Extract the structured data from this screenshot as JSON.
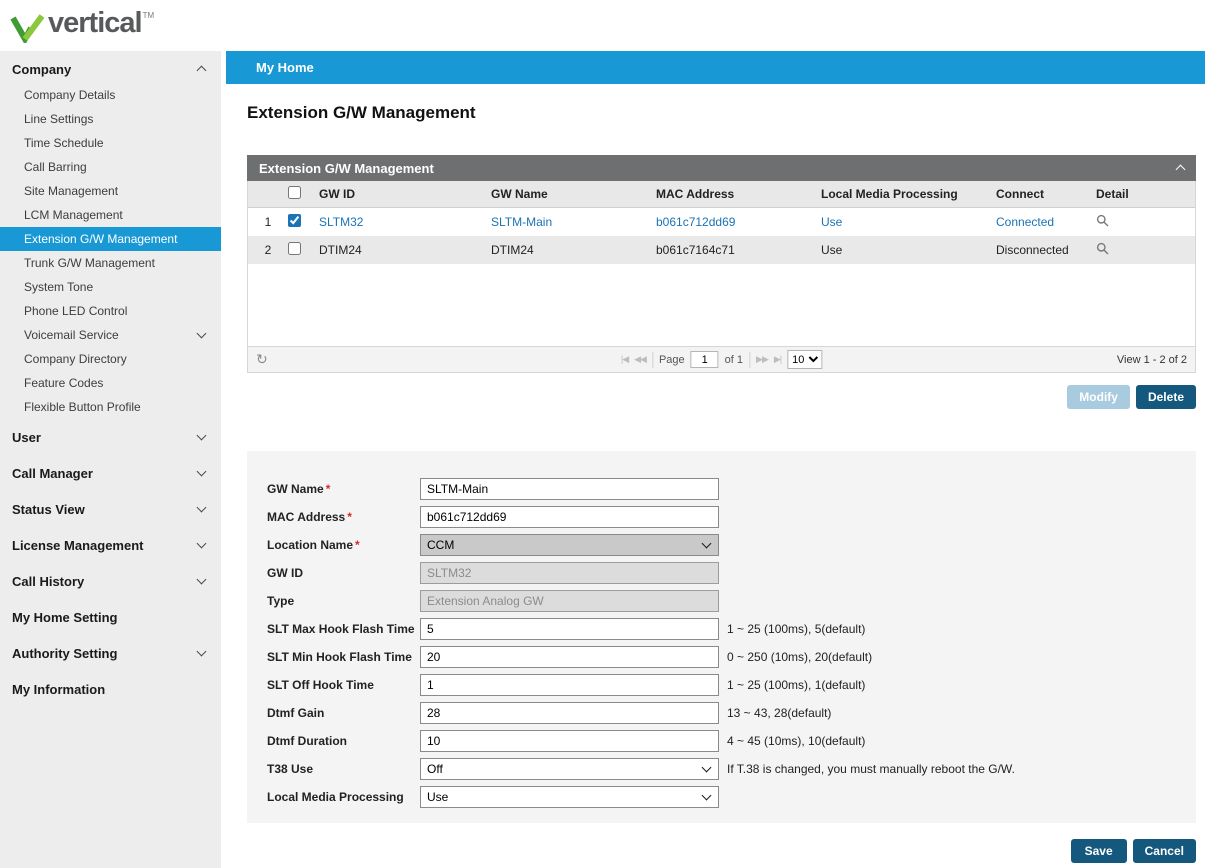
{
  "brand": {
    "logo_text": "vertical",
    "tm": "TM"
  },
  "colors": {
    "accent_blue": "#1899d6",
    "panel_header_gray": "#6e6f71",
    "link_blue": "#1a73b5",
    "button_dark": "#15587d",
    "button_light": "#a9cbdf",
    "logo_green_dark": "#3f9c35",
    "logo_green_light": "#8dc63f"
  },
  "sidebar": {
    "company": {
      "label": "Company",
      "items": [
        "Company Details",
        "Line Settings",
        "Time Schedule",
        "Call Barring",
        "Site Management",
        "LCM Management",
        "Extension G/W Management",
        "Trunk G/W Management",
        "System Tone",
        "Phone LED Control",
        "Voicemail Service",
        "Company Directory",
        "Feature Codes",
        "Flexible Button Profile"
      ]
    },
    "sections": [
      "User",
      "Call Manager",
      "Status View",
      "License Management",
      "Call History",
      "My Home Setting",
      "Authority Setting",
      "My Information"
    ]
  },
  "topbar": {
    "title": "My Home"
  },
  "page": {
    "title": "Extension G/W Management"
  },
  "table": {
    "panel_title": "Extension G/W Management",
    "columns": [
      "GW ID",
      "GW Name",
      "MAC Address",
      "Local Media Processing",
      "Connect",
      "Detail"
    ],
    "rows": [
      {
        "num": "1",
        "checked": true,
        "gw_id": "SLTM32",
        "gw_name": "SLTM-Main",
        "mac": "b061c712dd69",
        "local_media": "Use",
        "connect": "Connected"
      },
      {
        "num": "2",
        "checked": false,
        "gw_id": "DTIM24",
        "gw_name": "DTIM24",
        "mac": "b061c7164c71",
        "local_media": "Use",
        "connect": "Disconnected"
      }
    ]
  },
  "pager": {
    "page_label": "Page",
    "page_value": "1",
    "of_label": "of 1",
    "page_size": "10",
    "view_label": "View 1 - 2 of 2"
  },
  "icons": {
    "refresh": "↻",
    "pager_first": "|◀",
    "pager_prev": "◀◀",
    "pager_next": "▶▶",
    "pager_last": "▶|"
  },
  "actions": {
    "modify": "Modify",
    "delete": "Delete",
    "save": "Save",
    "cancel": "Cancel"
  },
  "form": {
    "required_mark": "*",
    "fields": [
      {
        "label": "GW Name",
        "required": true,
        "value": "SLTM-Main"
      },
      {
        "label": "MAC Address",
        "required": true,
        "value": "b061c712dd69"
      },
      {
        "label": "Location Name",
        "required": true,
        "value": "CCM"
      },
      {
        "label": "GW ID",
        "value": "SLTM32",
        "disabled": true
      },
      {
        "label": "Type",
        "value": "Extension Analog GW",
        "disabled": true
      },
      {
        "label": "SLT Max Hook Flash Time",
        "value": "5",
        "hint": "1 ~ 25 (100ms), 5(default)"
      },
      {
        "label": "SLT Min Hook Flash Time",
        "value": "20",
        "hint": "0 ~ 250 (10ms), 20(default)"
      },
      {
        "label": "SLT Off Hook Time",
        "value": "1",
        "hint": "1 ~ 25 (100ms), 1(default)"
      },
      {
        "label": "Dtmf Gain",
        "value": "28",
        "hint": "13 ~ 43, 28(default)"
      },
      {
        "label": "Dtmf Duration",
        "value": "10",
        "hint": "4 ~ 45 (10ms), 10(default)"
      },
      {
        "label": "T38 Use",
        "value": "Off",
        "hint": "If T.38 is changed, you must manually reboot the G/W."
      },
      {
        "label": "Local Media Processing",
        "value": "Use"
      }
    ]
  }
}
